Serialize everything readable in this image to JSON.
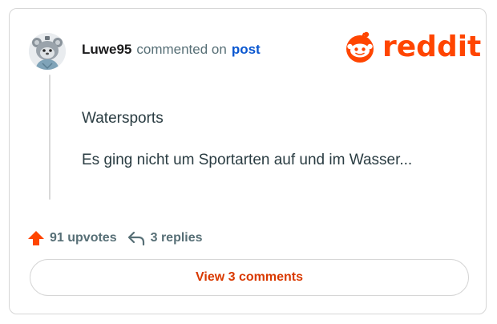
{
  "comment": {
    "username": "Luwe95",
    "commented_on_text": "commented on",
    "post_link_label": "post",
    "post_title": "Watersports",
    "body": "Es ging nicht um Sportarten auf und im Wasser..."
  },
  "brand": {
    "wordmark": "reddit",
    "color": "#ff4500"
  },
  "actions": {
    "upvotes_label": "91 upvotes",
    "replies_label": "3 replies"
  },
  "view_button": {
    "label": "View 3 comments"
  },
  "icons": {
    "upvote": "upvote-arrow-icon",
    "reply": "reply-arrow-icon",
    "logo": "reddit-snoo-icon",
    "avatar": "user-avatar"
  },
  "colors": {
    "accent": "#ff4500",
    "link": "#0a57d0",
    "button_text": "#d93900",
    "muted_text": "#576f76",
    "border": "#d6d6d6"
  }
}
